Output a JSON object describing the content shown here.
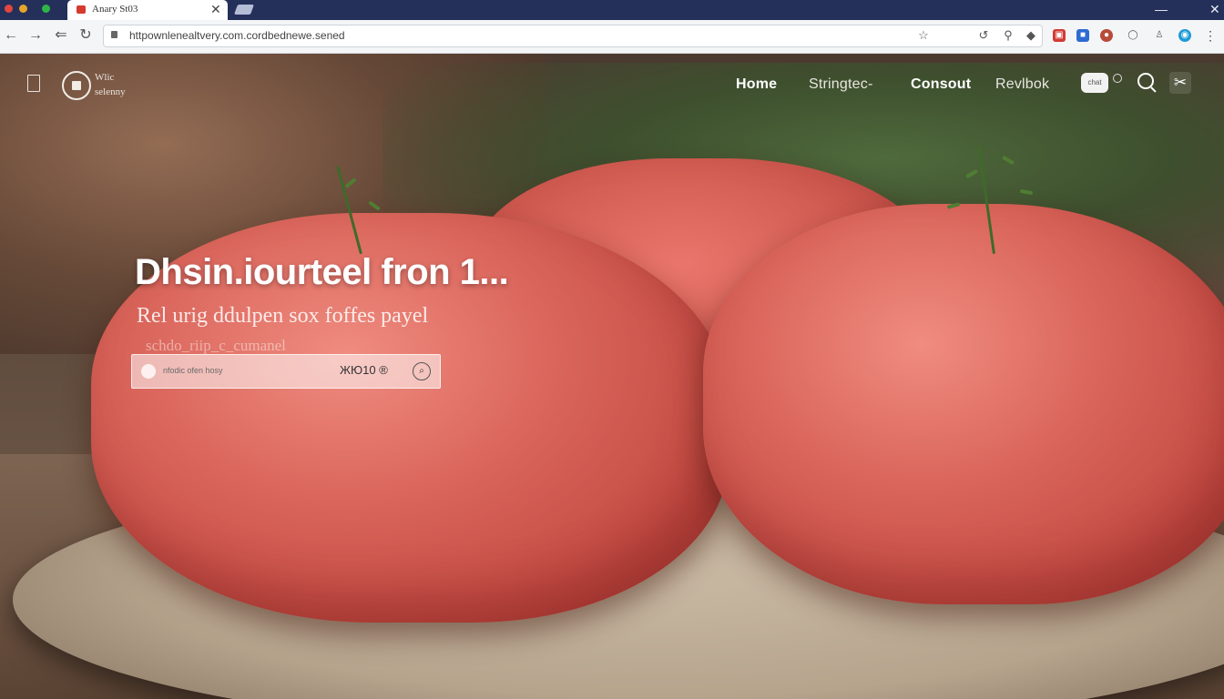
{
  "browser": {
    "tab_title": "Anary St03",
    "tab_close": "✕",
    "url": "httpownlenealtvery.com.cordbednewe.sened",
    "window_controls": {
      "minimize": "—",
      "close": "✕"
    },
    "nav_icons": [
      "back-icon",
      "forward-icon",
      "home-icon",
      "reload-icon"
    ],
    "url_icons": [
      "bookmark-star-icon",
      "refresh-icon",
      "search-icon",
      "extension-icon"
    ]
  },
  "site": {
    "logo_line1": "Wlic",
    "logo_line2": "selenny",
    "nav": [
      "Home",
      "Stringtec-",
      "Consout",
      "Revlbok"
    ],
    "chat_badge": "chat"
  },
  "hero": {
    "title": "Dhsin.iourteel fron 1...",
    "subtitle": "Rel urig ddulpen sox foffes payel",
    "faint_line": "schdo_riip_c_cumanel",
    "search_placeholder": "nfodic ofen hosy",
    "search_price": "ЖЮ10 ®",
    "search_go": "⌕"
  },
  "colors": {
    "tabbar": "#24305a",
    "toolbar": "#f4f5f7",
    "nav_text": "#ffffff",
    "meat": "#d9645a"
  }
}
